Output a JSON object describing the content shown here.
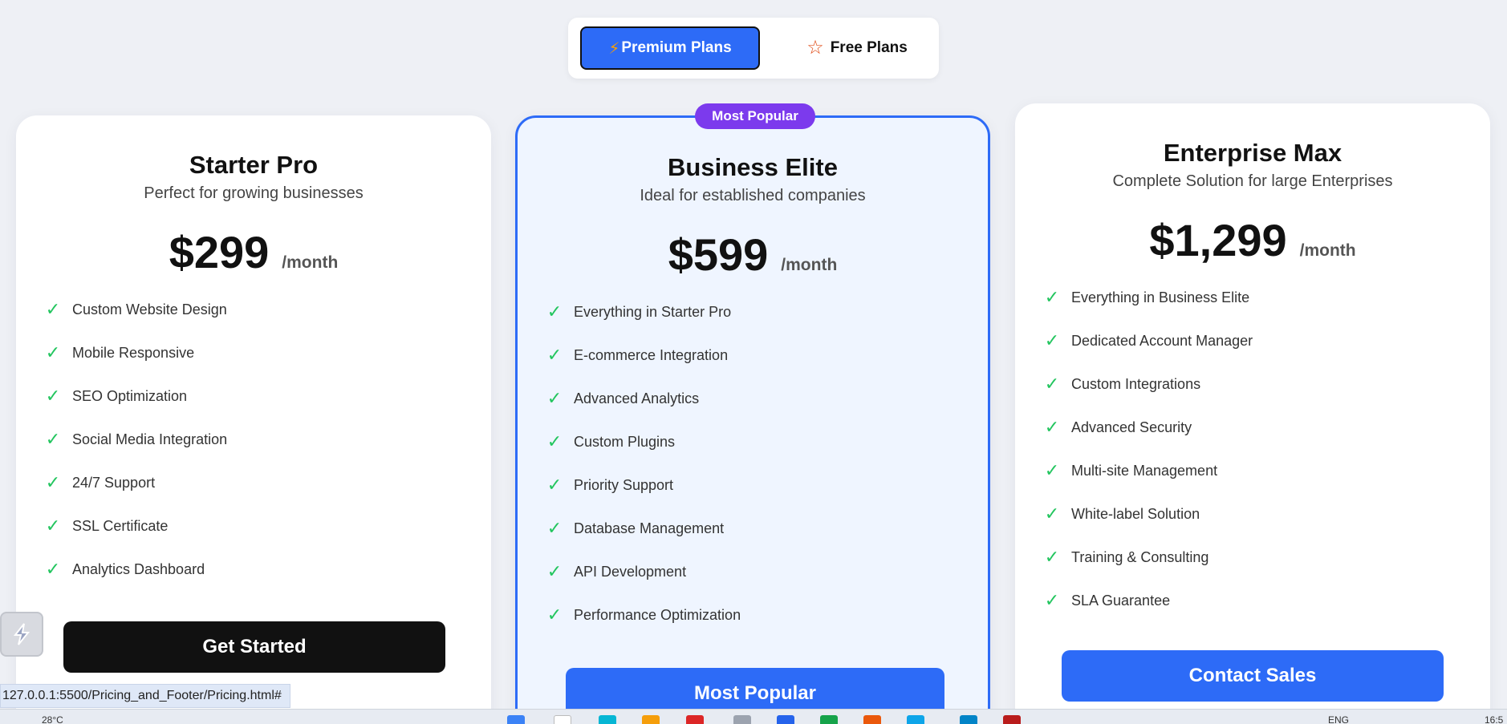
{
  "toggle": {
    "premium_icon": "⚡",
    "premium_label": "Premium Plans",
    "free_icon": "☆",
    "free_label": "Free Plans"
  },
  "plans": [
    {
      "name": "Starter Pro",
      "description": "Perfect for growing businesses",
      "price": "$299",
      "period": "/month",
      "features": [
        "Custom Website Design",
        "Mobile Responsive",
        "SEO Optimization",
        "Social Media Integration",
        "24/7 Support",
        "SSL Certificate",
        "Analytics Dashboard"
      ],
      "cta": "Get Started"
    },
    {
      "badge": "Most Popular",
      "name": "Business Elite",
      "description": "Ideal for established companies",
      "price": "$599",
      "period": "/month",
      "features": [
        "Everything in Starter Pro",
        "E-commerce Integration",
        "Advanced Analytics",
        "Custom Plugins",
        "Priority Support",
        "Database Management",
        "API Development",
        "Performance Optimization"
      ],
      "cta": "Most Popular"
    },
    {
      "name": "Enterprise Max",
      "description": "Complete Solution for large Enterprises",
      "price": "$1,299",
      "period": "/month",
      "features": [
        "Everything in Business Elite",
        "Dedicated Account Manager",
        "Custom Integrations",
        "Advanced Security",
        "Multi-site Management",
        "White-label Solution",
        "Training & Consulting",
        "SLA Guarantee"
      ],
      "cta": "Contact Sales"
    }
  ],
  "check_icon": "✓",
  "status_url": "127.0.0.1:5500/Pricing_and_Footer/Pricing.html#",
  "taskbar": {
    "temperature": "28°C",
    "language": "ENG",
    "time": "16:5"
  },
  "colors": {
    "primary": "#2d6bf7",
    "badge": "#7c3aed",
    "check": "#22c55e",
    "dark_button": "#111111"
  }
}
